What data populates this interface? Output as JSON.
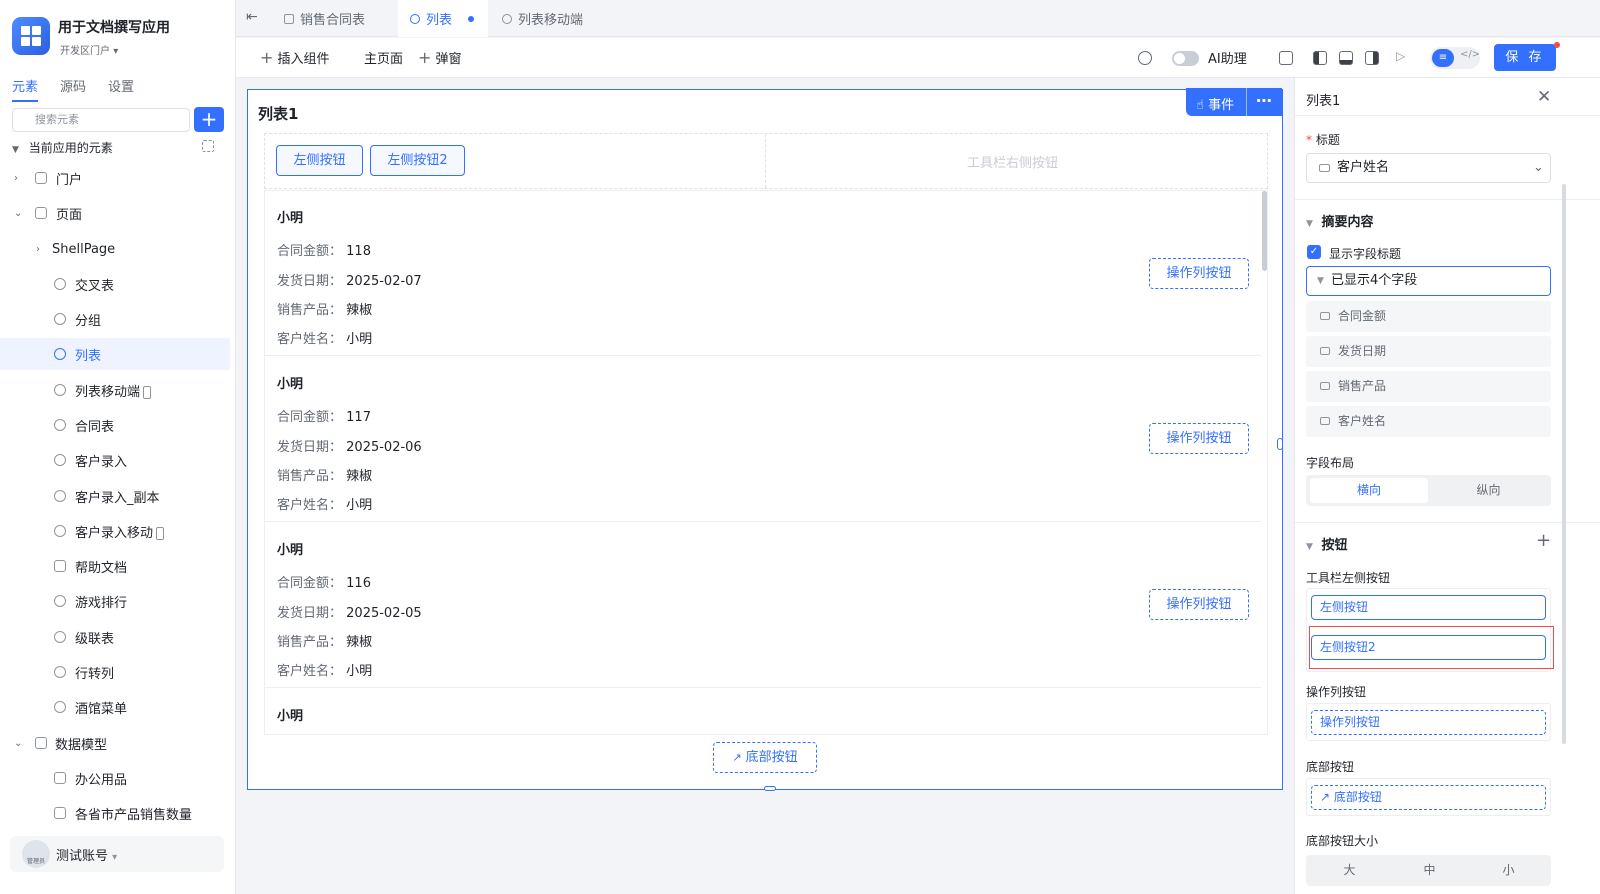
{
  "app": {
    "name": "用于文档撰写应用",
    "env": "开发区门户"
  },
  "sidebar": {
    "tabs": [
      "元素",
      "源码",
      "设置"
    ],
    "search_placeholder": "搜索元素",
    "section": "当前应用的元素",
    "items": [
      {
        "label": "门户"
      },
      {
        "label": "页面"
      },
      {
        "label": "ShellPage"
      },
      {
        "label": "交叉表"
      },
      {
        "label": "分组"
      },
      {
        "label": "列表"
      },
      {
        "label": "列表移动端"
      },
      {
        "label": "合同表"
      },
      {
        "label": "客户录入"
      },
      {
        "label": "客户录入_副本"
      },
      {
        "label": "客户录入移动"
      },
      {
        "label": "帮助文档"
      },
      {
        "label": "游戏排行"
      },
      {
        "label": "级联表"
      },
      {
        "label": "行转列"
      },
      {
        "label": "酒馆菜单"
      },
      {
        "label": "数据模型"
      },
      {
        "label": "办公用品"
      },
      {
        "label": "各省市产品销售数量"
      }
    ],
    "account": {
      "name": "测试账号",
      "role": "管理员"
    }
  },
  "tabs": [
    {
      "label": "销售合同表"
    },
    {
      "label": "列表"
    },
    {
      "label": "列表移动端"
    }
  ],
  "toolbar": {
    "insert": "插入组件",
    "main_page": "主页面",
    "popup": "弹窗",
    "ai": "AI助理",
    "save": "保 存"
  },
  "canvas": {
    "title": "列表1",
    "event_btn": "事件",
    "left_btn1": "左侧按钮",
    "left_btn2": "左侧按钮2",
    "right_placeholder": "工具栏右侧按钮",
    "action_btn": "操作列按钮",
    "bottom_btn": "底部按钮",
    "labels": {
      "amount": "合同金额：",
      "date": "发货日期：",
      "product": "销售产品：",
      "customer": "客户姓名："
    },
    "records": [
      {
        "title": "小明",
        "amount": "118",
        "date": "2025-02-07",
        "product": "辣椒",
        "customer": "小明"
      },
      {
        "title": "小明",
        "amount": "117",
        "date": "2025-02-06",
        "product": "辣椒",
        "customer": "小明"
      },
      {
        "title": "小明",
        "amount": "116",
        "date": "2025-02-05",
        "product": "辣椒",
        "customer": "小明"
      },
      {
        "title": "小明"
      }
    ]
  },
  "panel": {
    "title": "列表1",
    "title_label": "标题",
    "title_value": "客户姓名",
    "summary": "摘要内容",
    "show_field_title": "显示字段标题",
    "shown_fields": "已显示4个字段",
    "fields": [
      "合同金额",
      "发货日期",
      "销售产品",
      "客户姓名"
    ],
    "layout_label": "字段布局",
    "layout_options": [
      "横向",
      "纵向"
    ],
    "buttons_section": "按钮",
    "toolbar_left_label": "工具栏左侧按钮",
    "toolbar_left_btns": [
      "左侧按钮",
      "左侧按钮2"
    ],
    "action_label": "操作列按钮",
    "action_btn": "操作列按钮",
    "bottom_label": "底部按钮",
    "bottom_btn": "底部按钮",
    "bottom_size_label": "底部按钮大小",
    "size_options": [
      "大",
      "中",
      "小"
    ]
  }
}
